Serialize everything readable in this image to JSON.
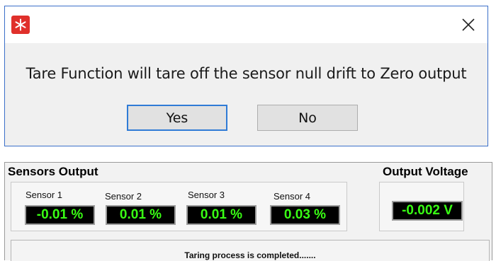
{
  "dialog": {
    "message": "Tare Function will tare off the sensor null drift to Zero output",
    "yes_label": "Yes",
    "no_label": "No",
    "icon": "app-snowflake-icon",
    "close_icon": "close-icon"
  },
  "panel": {
    "title": "Sensors Output",
    "output_title": "Output Voltage",
    "sensors": [
      {
        "label": "Sensor 1",
        "value": "-0.01 %"
      },
      {
        "label": "Sensor 2",
        "value": "0.01 %"
      },
      {
        "label": "Sensor 3",
        "value": "0.01 %"
      },
      {
        "label": "Sensor 4",
        "value": "0.03 %"
      }
    ],
    "voltage": "-0.002 V",
    "status": "Taring process is completed......."
  },
  "colors": {
    "accent": "#2f7bd6",
    "readout_bg": "#000000",
    "readout_text": "#39ff14",
    "app_icon": "#e0302b"
  }
}
